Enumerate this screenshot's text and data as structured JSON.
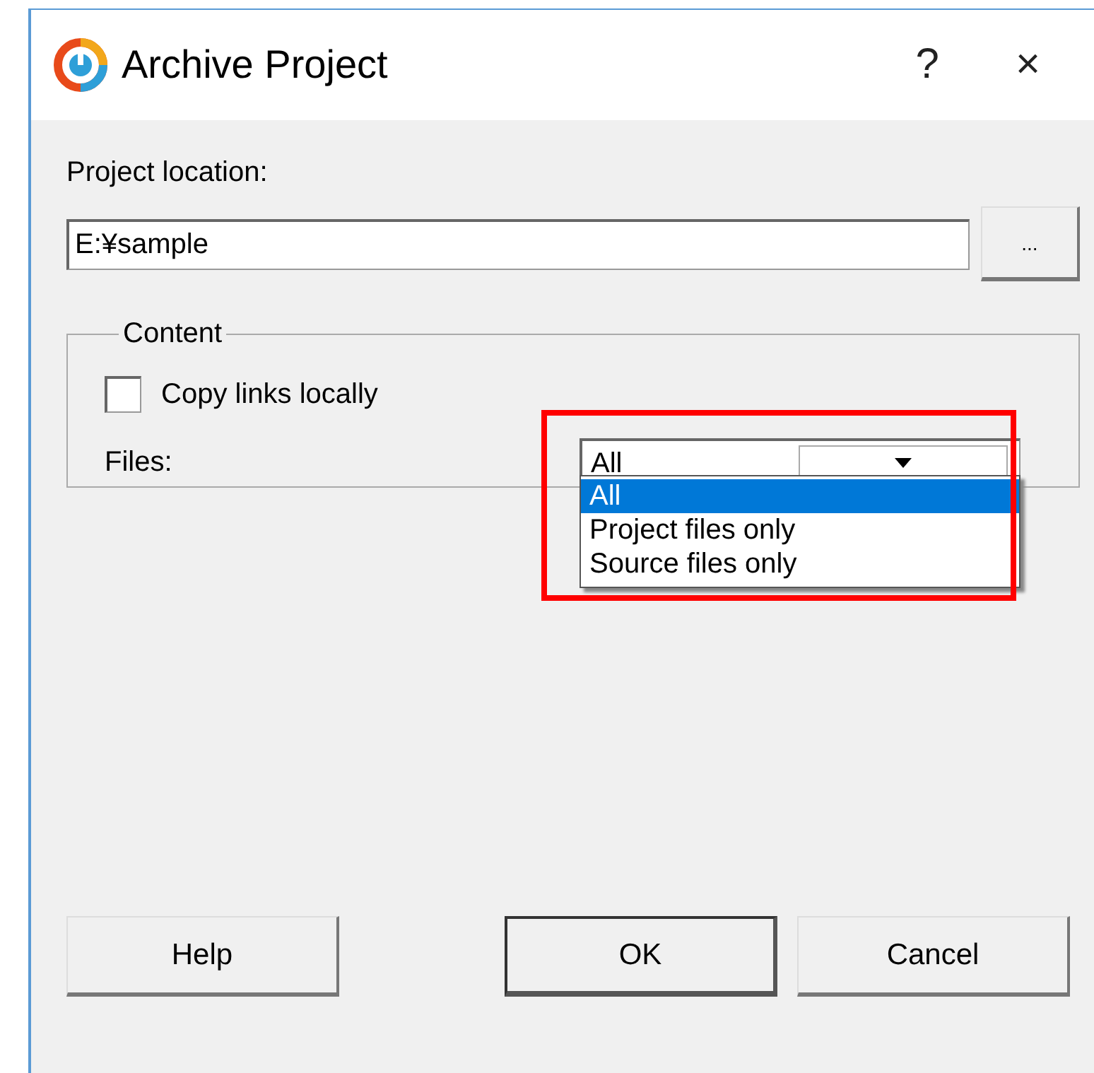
{
  "window": {
    "title": "Archive Project",
    "help_button": "?",
    "close_button": "×"
  },
  "project_location": {
    "label": "Project location:",
    "value": "E:¥sample",
    "browse_button": "..."
  },
  "content": {
    "title": "Content",
    "copy_links": {
      "label": "Copy links locally",
      "checked": false
    },
    "files": {
      "label": "Files:",
      "value": "All",
      "expanded": true,
      "highlighted": true,
      "options": [
        {
          "label": "All",
          "selected": true
        },
        {
          "label": "Project files only",
          "selected": false
        },
        {
          "label": "Source files only",
          "selected": false
        }
      ]
    }
  },
  "buttons": [
    {
      "label": "Help",
      "default": false
    },
    {
      "label": "OK",
      "default": true
    },
    {
      "label": "Cancel",
      "default": false
    }
  ]
}
